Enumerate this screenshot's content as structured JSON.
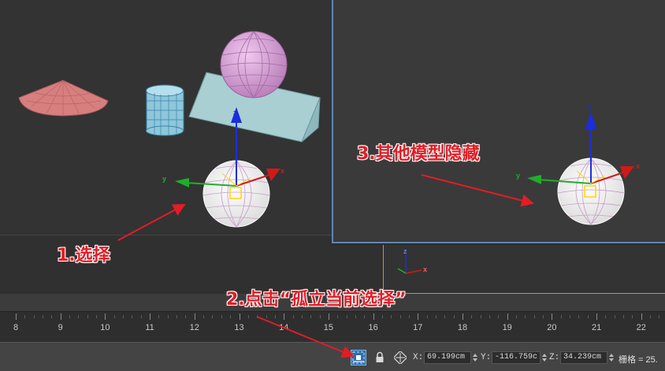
{
  "annotations": {
    "step1": "1.选择",
    "step2": "2.点击“孤立当前选择”",
    "step3": "3.其他模型隐藏"
  },
  "timeline": {
    "ticks": [
      "8",
      "9",
      "10",
      "11",
      "12",
      "13",
      "14",
      "15",
      "16",
      "17",
      "18",
      "19",
      "20",
      "21",
      "22"
    ]
  },
  "gizmo_axes": {
    "x": "x",
    "y": "y",
    "z": "z"
  },
  "statusbar": {
    "isolate_icon": "isolate-selection-icon",
    "lock_icon": "lock-icon",
    "abs_icon": "absolute-mode-icon",
    "x_label": "X:",
    "x_value": "69.199cm",
    "y_label": "Y:",
    "y_value": "-116.759c",
    "z_label": "Z:",
    "z_value": "34.239cm",
    "grid_label": "栅格 = 25."
  },
  "colors": {
    "annotation": "#e11d26",
    "active_viewport_border": "#5f86b0",
    "isolate_button": "#2f6fa8",
    "axis_x": "#d01a1a",
    "axis_y": "#1fae2b",
    "axis_z": "#1a2ee0"
  }
}
